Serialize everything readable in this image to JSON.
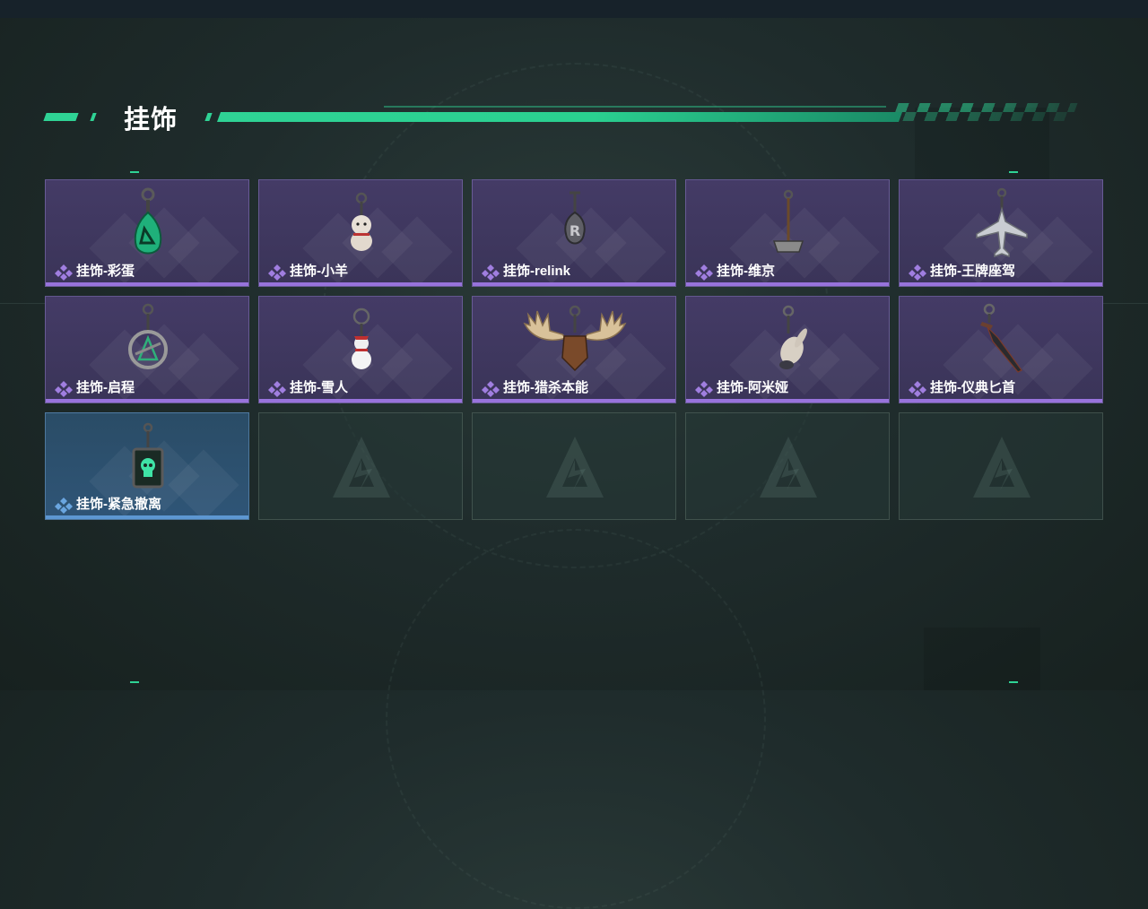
{
  "section": {
    "title": "挂饰"
  },
  "colors": {
    "accent": "#2fd395",
    "rare": "#9873dc",
    "common": "#5d97d2"
  },
  "items": [
    {
      "label": "挂饰-彩蛋",
      "rarity": "purple",
      "icon": "egg-charm-icon"
    },
    {
      "label": "挂饰-小羊",
      "rarity": "purple",
      "icon": "lamb-charm-icon"
    },
    {
      "label": "挂饰-relink",
      "rarity": "purple",
      "icon": "relink-charm-icon"
    },
    {
      "label": "挂饰-维京",
      "rarity": "purple",
      "icon": "viking-hammer-charm-icon"
    },
    {
      "label": "挂饰-王牌座驾",
      "rarity": "purple",
      "icon": "jet-plane-charm-icon"
    },
    {
      "label": "挂饰-启程",
      "rarity": "purple",
      "icon": "medallion-charm-icon"
    },
    {
      "label": "挂饰-雪人",
      "rarity": "purple",
      "icon": "snowman-charm-icon"
    },
    {
      "label": "挂饰-猎杀本能",
      "rarity": "purple",
      "icon": "moose-antlers-charm-icon"
    },
    {
      "label": "挂饰-阿米娅",
      "rarity": "purple",
      "icon": "bunny-charm-icon"
    },
    {
      "label": "挂饰-仪典匕首",
      "rarity": "purple",
      "icon": "dagger-charm-icon"
    },
    {
      "label": "挂饰-紧急撤离",
      "rarity": "blue",
      "icon": "skull-box-charm-icon"
    }
  ],
  "empty_slots": 4
}
